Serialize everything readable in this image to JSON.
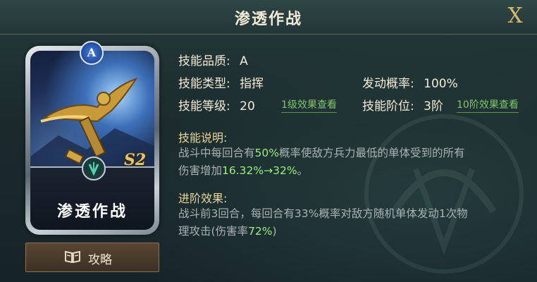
{
  "dialog": {
    "title": "渗透作战",
    "close_label": "X"
  },
  "card": {
    "name": "渗透作战",
    "quality_badge": "A",
    "season_tag": "S2",
    "strategy_button": "攻略"
  },
  "info": {
    "quality_key": "技能品质:",
    "quality_value": "A",
    "type_key": "技能类型:",
    "type_value": "指挥",
    "trigger_key": "发动概率:",
    "trigger_value": "100%",
    "level_key": "技能等级:",
    "level_value": "20",
    "level_link": "1级效果查看",
    "rank_key": "技能阶位:",
    "rank_value": "3阶",
    "rank_link": "10阶效果查看"
  },
  "description": {
    "heading": "技能说明:",
    "line1_a": "战斗中每回合有",
    "line1_hl": "50%",
    "line1_b": "概率使敌方兵力最低的单体受到的所有",
    "line2_a": "伤害增加",
    "line2_hl": "16.32%→32%",
    "line2_b": "。"
  },
  "advanced": {
    "heading": "进阶效果:",
    "line1": "战斗前3回合，每回合有33%概率对敌方随机单体发动1次物",
    "line2_a": "理攻击(伤害率",
    "line2_hl": "72%",
    "line2_b": ")"
  },
  "colors": {
    "highlight": "#9bf080",
    "link": "#7fc76a",
    "heading": "#e8d69a",
    "close": "#d9b76a"
  },
  "icons": [
    "close-icon",
    "quality-a-badge",
    "emblem-icon",
    "book-icon"
  ]
}
